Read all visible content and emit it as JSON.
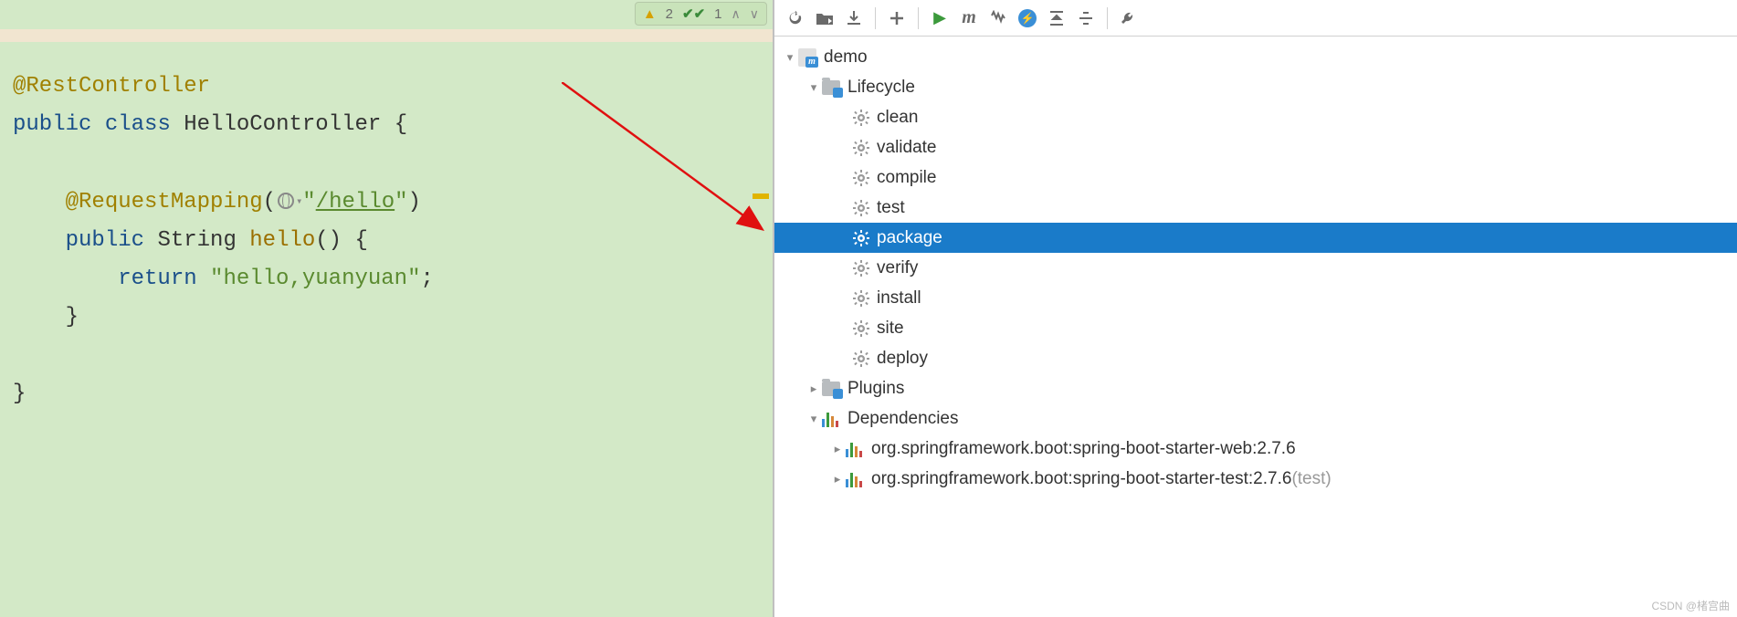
{
  "inspection": {
    "warnings": "2",
    "checks": "1"
  },
  "code": {
    "annotation1": "@RestController",
    "kw_public": "public",
    "kw_class": "class",
    "class_name": "HelloController",
    "brace_open": " {",
    "annotation2": "@RequestMapping",
    "paren_open": "(",
    "url_string_open": "\"",
    "url_path": "/hello",
    "url_string_close": "\"",
    "paren_close": ")",
    "kw_public2": "public",
    "ret_type": "String",
    "method_name": "hello",
    "method_parens": "()",
    "method_brace_open": " {",
    "kw_return": "return",
    "ret_string": "\"hello,yuanyuan\"",
    "semicolon": ";",
    "method_brace_close": "}",
    "class_brace_close": "}"
  },
  "maven": {
    "root": "demo",
    "lifecycle": {
      "label": "Lifecycle",
      "goals": [
        "clean",
        "validate",
        "compile",
        "test",
        "package",
        "verify",
        "install",
        "site",
        "deploy"
      ]
    },
    "plugins": "Plugins",
    "dependencies_label": "Dependencies",
    "dependencies": [
      {
        "name": "org.springframework.boot:spring-boot-starter-web:2.7.6",
        "scope": ""
      },
      {
        "name": "org.springframework.boot:spring-boot-starter-test:2.7.6",
        "scope": "(test)"
      }
    ],
    "selected_goal": "package"
  },
  "watermark": "CSDN @楮宫曲"
}
